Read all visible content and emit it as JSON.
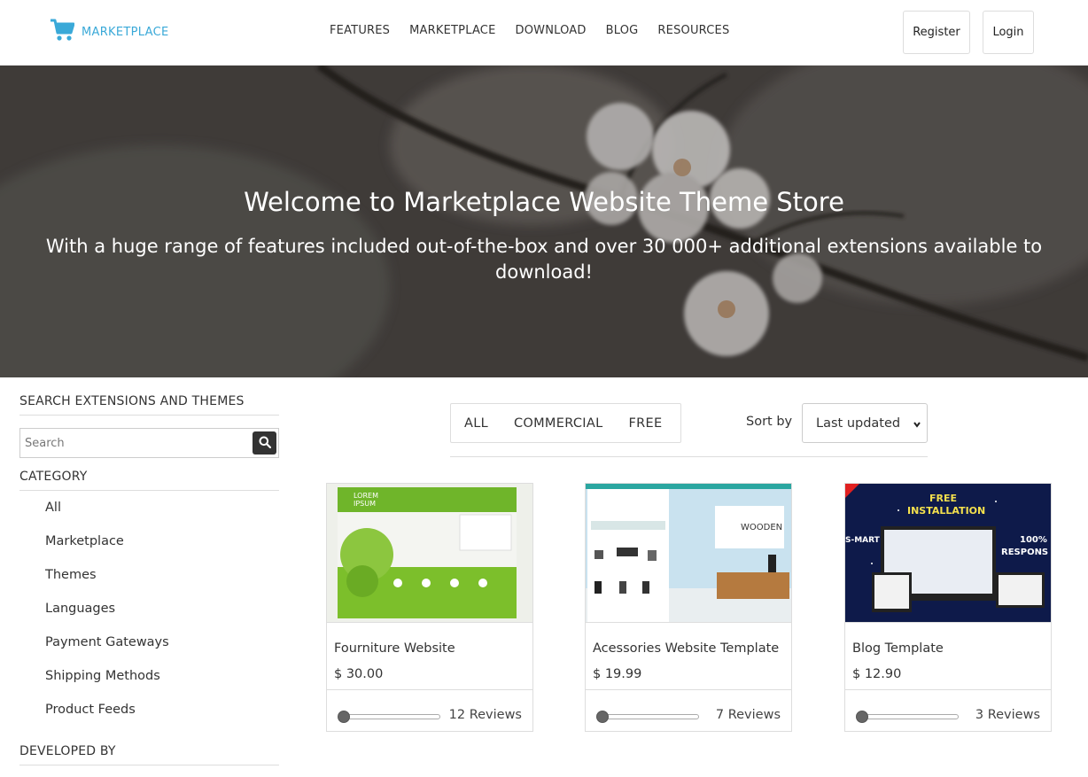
{
  "header": {
    "logo_text": "MARKETPLACE",
    "nav": [
      "FEATURES",
      "MARKETPLACE",
      "DOWNLOAD",
      "BLOG",
      "RESOURCES"
    ],
    "register_label": "Register",
    "login_label": "Login",
    "accent_color": "#3aa9d8"
  },
  "hero": {
    "title": "Welcome to Marketplace Website Theme Store",
    "subtitle": "With a huge range of features included out-of-the-box and over 30 000+ additional extensions available to download!"
  },
  "sidebar": {
    "search_heading": "SEARCH EXTENSIONS AND THEMES",
    "search_placeholder": "Search",
    "category_heading": "CATEGORY",
    "categories": [
      "All",
      "Marketplace",
      "Themes",
      "Languages",
      "Payment Gateways",
      "Shipping Methods",
      "Product Feeds"
    ],
    "developed_by_heading": "DEVELOPED BY"
  },
  "filters": {
    "tabs": [
      "ALL",
      "COMMERCIAL",
      "FREE"
    ],
    "sort_label": "Sort by",
    "sort_selected": "Last updated"
  },
  "products": [
    {
      "title": "Fourniture Website",
      "price": "$ 30.00",
      "reviews": "12 Reviews",
      "rating_slider": 0,
      "image_text": [
        "LOREM",
        "IPSUM"
      ]
    },
    {
      "title": "Acessories Website Template",
      "price": "$ 19.99",
      "reviews": "7 Reviews",
      "rating_slider": 0,
      "image_text": [
        "WOODEN"
      ]
    },
    {
      "title": "Blog Template",
      "price": "$ 12.90",
      "reviews": "3 Reviews",
      "rating_slider": 0,
      "image_text": [
        "FREE",
        "INSTALLATION",
        "100%",
        "RESPONS",
        "S-MART"
      ]
    }
  ]
}
